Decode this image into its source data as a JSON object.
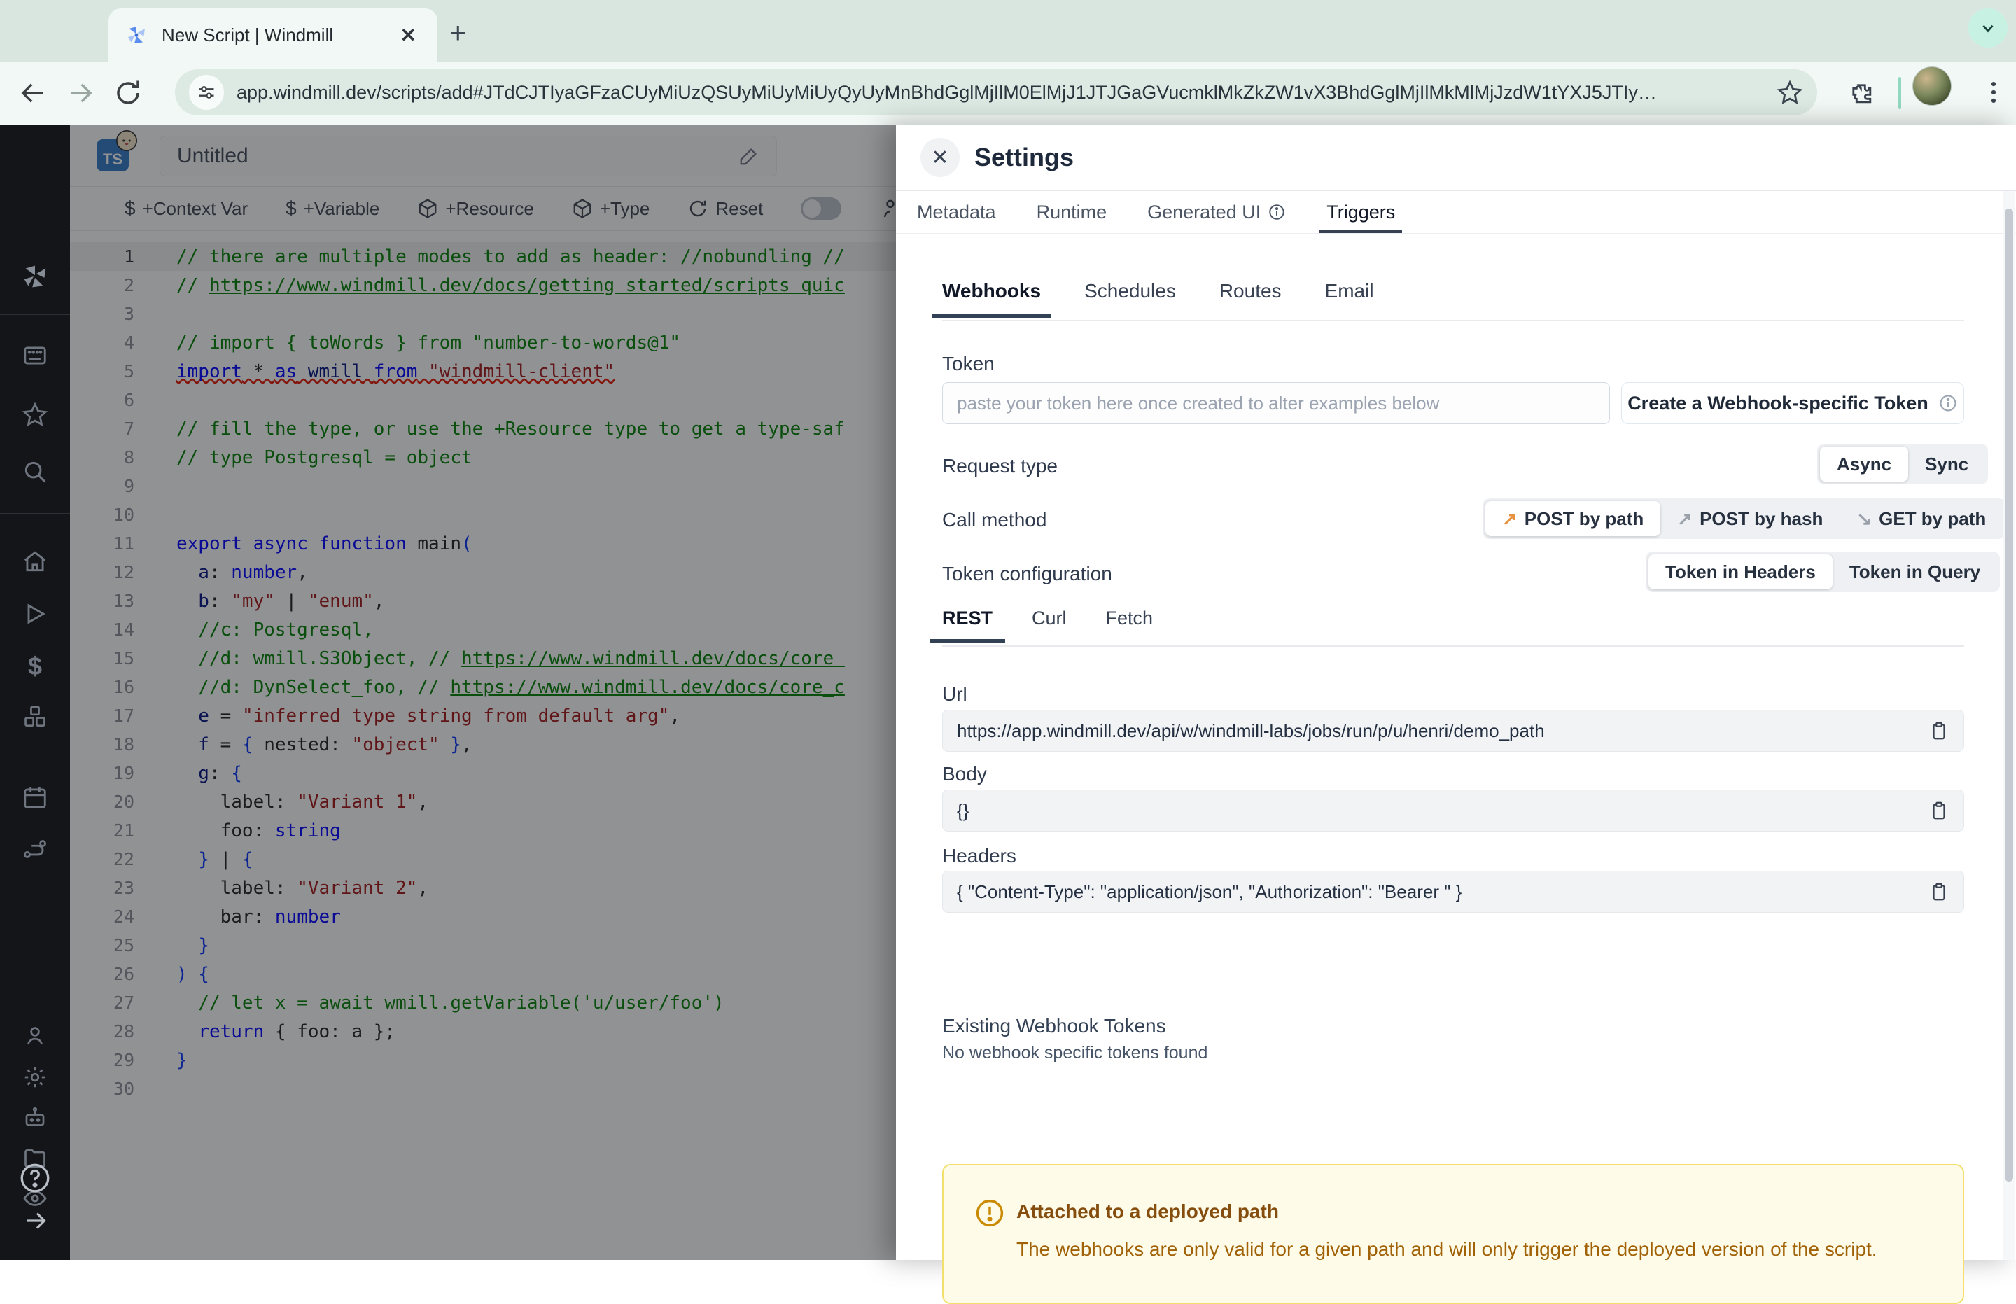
{
  "browser": {
    "tab_title": "New Script | Windmill",
    "url": "app.windmill.dev/scripts/add#JTdCJTIyaGFzaCUyMiUzQSUyMiUyMiUyQyUyMnBhdGglMjIlM0ElMjJ1JTJGaGVucmklMkZkZW1vX3BhdGglMjIlMkMlMjJzdW1tYXJ5JTIy…"
  },
  "sidebar": {
    "items": [
      "windmill-logo",
      "workspace",
      "favorites",
      "search",
      "home",
      "runs",
      "variables",
      "resources",
      "schedules",
      "routes",
      "users",
      "settings",
      "workers",
      "folders",
      "audit-logs",
      "help",
      "expand"
    ]
  },
  "editor": {
    "badge": "TS",
    "title": "Untitled",
    "toolbar": [
      "+Context Var",
      "+Variable",
      "+Resource",
      "+Type",
      "Reset"
    ],
    "code": [
      {
        "n": 1,
        "s": [
          [
            "c",
            "// there are multiple modes to add as header: //nobundling //"
          ]
        ]
      },
      {
        "n": 2,
        "s": [
          [
            "c",
            "// "
          ],
          [
            "lk",
            "https://www.windmill.dev/docs/getting_started/scripts_quic"
          ]
        ]
      },
      {
        "n": 3,
        "s": []
      },
      {
        "n": 4,
        "s": [
          [
            "c",
            "// import { toWords } from \"number-to-words@1\""
          ]
        ]
      },
      {
        "n": 5,
        "sq": true,
        "s": [
          [
            "k",
            "import"
          ],
          [
            "d",
            " * "
          ],
          [
            "k",
            "as"
          ],
          [
            "v",
            " wmill "
          ],
          [
            "k",
            "from"
          ],
          [
            "s",
            " \"windmill-client\""
          ]
        ]
      },
      {
        "n": 6,
        "s": []
      },
      {
        "n": 7,
        "s": [
          [
            "c",
            "// fill the type, or use the +Resource type to get a type-saf"
          ]
        ]
      },
      {
        "n": 8,
        "s": [
          [
            "c",
            "// type Postgresql = object"
          ]
        ]
      },
      {
        "n": 9,
        "s": []
      },
      {
        "n": 10,
        "s": []
      },
      {
        "n": 11,
        "s": [
          [
            "k",
            "export"
          ],
          [
            "d",
            " "
          ],
          [
            "k",
            "async"
          ],
          [
            "d",
            " "
          ],
          [
            "k",
            "function"
          ],
          [
            "d",
            " main"
          ],
          [
            "b",
            "("
          ]
        ]
      },
      {
        "n": 12,
        "s": [
          [
            "v",
            "  a"
          ],
          [
            "d",
            ": "
          ],
          [
            "k",
            "number"
          ],
          [
            "d",
            ","
          ]
        ]
      },
      {
        "n": 13,
        "s": [
          [
            "v",
            "  b"
          ],
          [
            "d",
            ": "
          ],
          [
            "s",
            "\"my\""
          ],
          [
            "d",
            " | "
          ],
          [
            "s",
            "\"enum\""
          ],
          [
            "d",
            ","
          ]
        ]
      },
      {
        "n": 14,
        "s": [
          [
            "c",
            "  //c: Postgresql,"
          ]
        ]
      },
      {
        "n": 15,
        "s": [
          [
            "c",
            "  //d: wmill.S3Object, // "
          ],
          [
            "lk",
            "https://www.windmill.dev/docs/core_"
          ]
        ]
      },
      {
        "n": 16,
        "s": [
          [
            "c",
            "  //d: DynSelect_foo, // "
          ],
          [
            "lk",
            "https://www.windmill.dev/docs/core_c"
          ]
        ]
      },
      {
        "n": 17,
        "s": [
          [
            "v",
            "  e"
          ],
          [
            "d",
            " = "
          ],
          [
            "s",
            "\"inferred type string from default arg\""
          ],
          [
            "d",
            ","
          ]
        ]
      },
      {
        "n": 18,
        "s": [
          [
            "v",
            "  f"
          ],
          [
            "d",
            " = "
          ],
          [
            "b",
            "{"
          ],
          [
            "d",
            " nested: "
          ],
          [
            "s",
            "\"object\""
          ],
          [
            "d",
            " "
          ],
          [
            "b",
            "}"
          ],
          [
            "d",
            ","
          ]
        ]
      },
      {
        "n": 19,
        "s": [
          [
            "v",
            "  g"
          ],
          [
            "d",
            ": "
          ],
          [
            "b",
            "{"
          ]
        ]
      },
      {
        "n": 20,
        "s": [
          [
            "d",
            "    label: "
          ],
          [
            "s",
            "\"Variant 1\""
          ],
          [
            "d",
            ","
          ]
        ]
      },
      {
        "n": 21,
        "s": [
          [
            "d",
            "    foo: "
          ],
          [
            "k",
            "string"
          ]
        ]
      },
      {
        "n": 22,
        "s": [
          [
            "d",
            "  "
          ],
          [
            "b",
            "}"
          ],
          [
            "d",
            " | "
          ],
          [
            "b",
            "{"
          ]
        ]
      },
      {
        "n": 23,
        "s": [
          [
            "d",
            "    label: "
          ],
          [
            "s",
            "\"Variant 2\""
          ],
          [
            "d",
            ","
          ]
        ]
      },
      {
        "n": 24,
        "s": [
          [
            "d",
            "    bar: "
          ],
          [
            "k",
            "number"
          ]
        ]
      },
      {
        "n": 25,
        "s": [
          [
            "d",
            "  "
          ],
          [
            "b",
            "}"
          ]
        ]
      },
      {
        "n": 26,
        "s": [
          [
            "b",
            ") {"
          ]
        ]
      },
      {
        "n": 27,
        "s": [
          [
            "c",
            "  // let x = await wmill.getVariable('u/user/foo')"
          ]
        ]
      },
      {
        "n": 28,
        "s": [
          [
            "k",
            "  return"
          ],
          [
            "d",
            " { foo: a };"
          ]
        ]
      },
      {
        "n": 29,
        "s": [
          [
            "b",
            "}"
          ]
        ]
      },
      {
        "n": 30,
        "s": []
      }
    ]
  },
  "drawer": {
    "title": "Settings",
    "tabs": [
      "Metadata",
      "Runtime",
      "Generated UI",
      "Triggers"
    ],
    "trigger_tabs": [
      "Webhooks",
      "Schedules",
      "Routes",
      "Email"
    ],
    "token": {
      "label": "Token",
      "placeholder": "paste your token here once created to alter examples below",
      "create_button": "Create a Webhook-specific Token"
    },
    "request_type": {
      "label": "Request type",
      "options": [
        "Async",
        "Sync"
      ]
    },
    "call_method": {
      "label": "Call method",
      "options": [
        "POST by path",
        "POST by hash",
        "GET by path"
      ]
    },
    "token_config": {
      "label": "Token configuration",
      "options": [
        "Token in Headers",
        "Token in Query"
      ]
    },
    "example_tabs": [
      "REST",
      "Curl",
      "Fetch"
    ],
    "url": {
      "label": "Url",
      "value": "https://app.windmill.dev/api/w/windmill-labs/jobs/run/p/u/henri/demo_path"
    },
    "body": {
      "label": "Body",
      "value": "{}"
    },
    "headers": {
      "label": "Headers",
      "value": "{ \"Content-Type\": \"application/json\", \"Authorization\": \"Bearer \" }"
    },
    "existing": {
      "heading": "Existing Webhook Tokens",
      "empty": "No webhook specific tokens found"
    },
    "warning": {
      "title": "Attached to a deployed path",
      "body": "The webhooks are only valid for a given path and will only trigger the deployed version of the script."
    }
  }
}
